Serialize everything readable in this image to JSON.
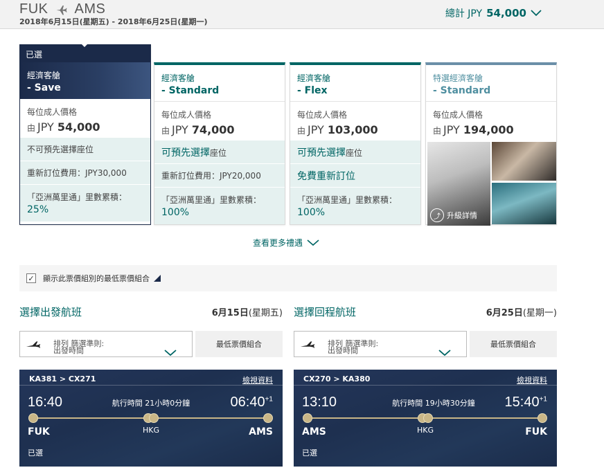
{
  "header": {
    "origin": "FUK",
    "destination": "AMS",
    "dates": "2018年6月15日(星期五) - 2018年6月25日(星期一)",
    "total_label": "總計 JPY",
    "total_amount": "54,000"
  },
  "fares": [
    {
      "selected_label": "已選",
      "cabin": "經濟客艙",
      "fare": "- Save",
      "price_label": "每位成人價格",
      "from": "由",
      "currency": "JPY",
      "amount": "54,000",
      "seat": "不可預先選擇座位",
      "rebook": "重新訂位費用：JPY30,000",
      "miles_label": "「亞洲萬里通」里數累積：",
      "miles": "25%"
    },
    {
      "cabin": "經濟客艙",
      "fare": "- Standard",
      "price_label": "每位成人價格",
      "from": "由",
      "currency": "JPY",
      "amount": "74,000",
      "seat_big": "可預先選擇",
      "seat_small": "座位",
      "rebook": "重新訂位費用：JPY20,000",
      "miles_label": "「亞洲萬里通」里數累積：",
      "miles": "100%"
    },
    {
      "cabin": "經濟客艙",
      "fare": "- Flex",
      "price_label": "每位成人價格",
      "from": "由",
      "currency": "JPY",
      "amount": "103,000",
      "seat_big": "可預先選擇",
      "seat_small": "座位",
      "rebook_big": "免費重新訂位",
      "miles_label": "「亞洲萬里通」里數累積：",
      "miles": "100%"
    },
    {
      "cabin": "特選經濟客艙",
      "fare": "- Standard",
      "price_label": "每位成人價格",
      "from": "由",
      "currency": "JPY",
      "amount": "194,000",
      "upgrade": "升級詳情"
    }
  ],
  "more_options": "查看更多禮遇",
  "checkbox_label": "顯示此票價組別的最低票價組合",
  "outbound": {
    "title": "選擇出發航班",
    "date_num": "6月15日",
    "date_day": "(星期五)",
    "sort_label_1": "排列 篩選準則:",
    "sort_label_2": "出發時間",
    "lowest_button": "最低票價組合",
    "flight": {
      "numbers": "KA381 > CX271",
      "details": "檢視資料",
      "dep_time": "16:40",
      "duration": "航行時間 21小時0分鐘",
      "arr_time": "06:40",
      "day_offset": "+1",
      "origin": "FUK",
      "hub": "HKG",
      "dest": "AMS",
      "status": "已選"
    }
  },
  "inbound": {
    "title": "選擇回程航班",
    "date_num": "6月25日",
    "date_day": "(星期一)",
    "sort_label_1": "排列 篩選準則:",
    "sort_label_2": "出發時間",
    "lowest_button": "最低票價組合",
    "flight": {
      "numbers": "CX270 > KA380",
      "details": "檢視資料",
      "dep_time": "13:10",
      "duration": "航行時間 19小時30分鐘",
      "arr_time": "15:40",
      "day_offset": "+1",
      "origin": "AMS",
      "hub": "HKG",
      "dest": "FUK",
      "status": "已選"
    }
  },
  "colors": {
    "teal": "#006564",
    "navy": "#1b2a49",
    "gold": "#c9b687"
  }
}
